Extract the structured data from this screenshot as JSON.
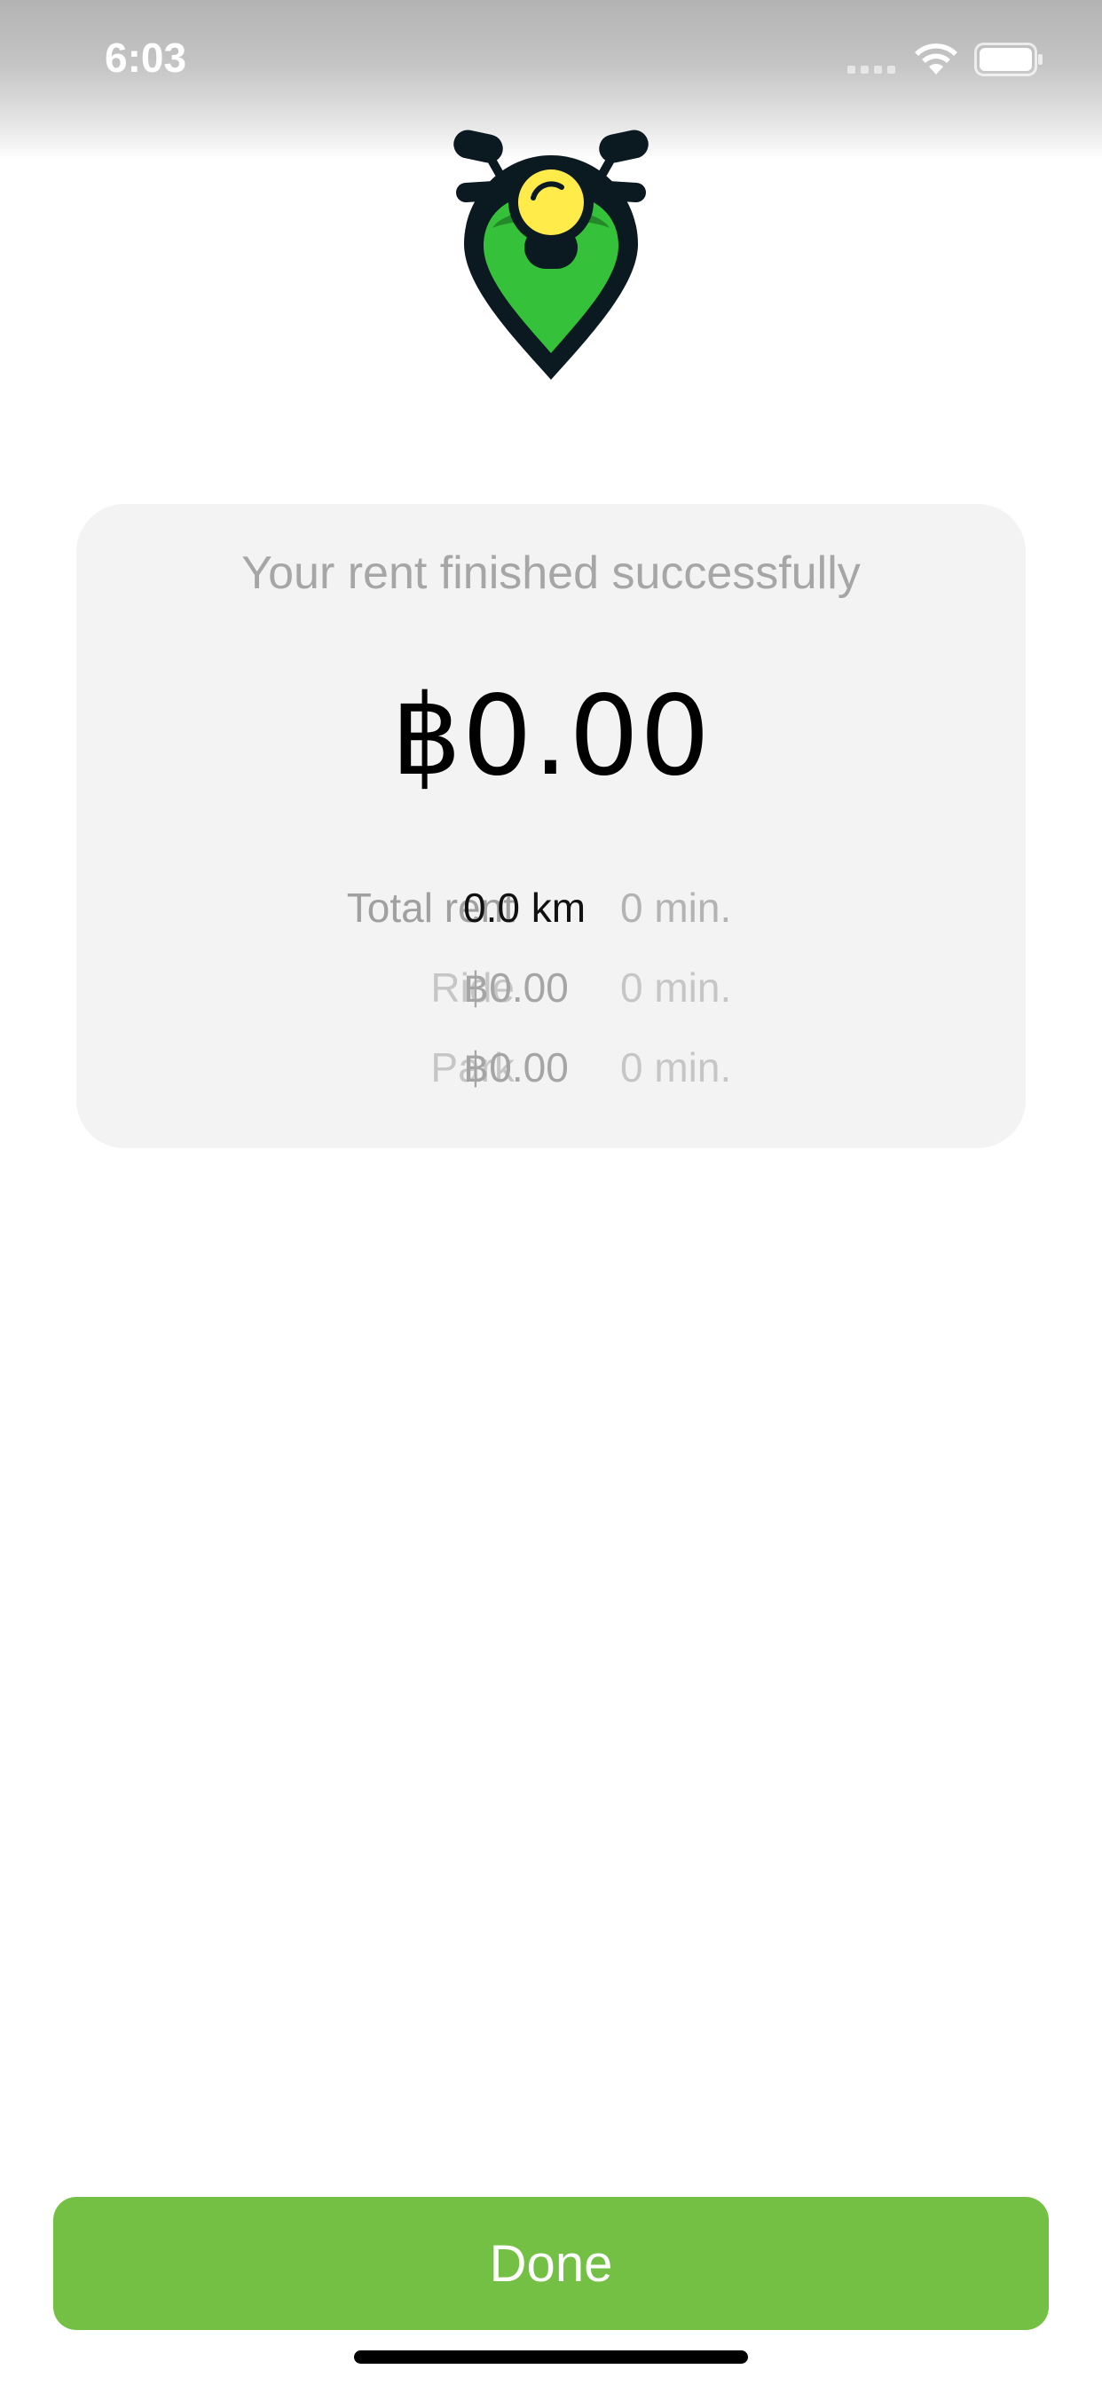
{
  "status_bar": {
    "time": "6:03"
  },
  "icons": {
    "logo": "scooter-pin-logo-icon",
    "signal": "cellular-signal-icon",
    "wifi": "wifi-icon",
    "battery": "battery-icon"
  },
  "colors": {
    "accent_green": "#74c044",
    "logo_green": "#35c23a",
    "logo_yellow": "#ffec4a",
    "logo_dark": "#0b1920",
    "card_background": "#f3f3f3"
  },
  "summary": {
    "title": "Your rent finished successfully",
    "total_amount": "฿0.00",
    "rows": [
      {
        "label": "Total rent",
        "value": "0.0 km",
        "time": "0 min."
      },
      {
        "label": "Ride",
        "value": "฿0.00",
        "time": "0 min."
      },
      {
        "label": "Park",
        "value": "฿0.00",
        "time": "0 min."
      }
    ]
  },
  "actions": {
    "done_label": "Done"
  }
}
